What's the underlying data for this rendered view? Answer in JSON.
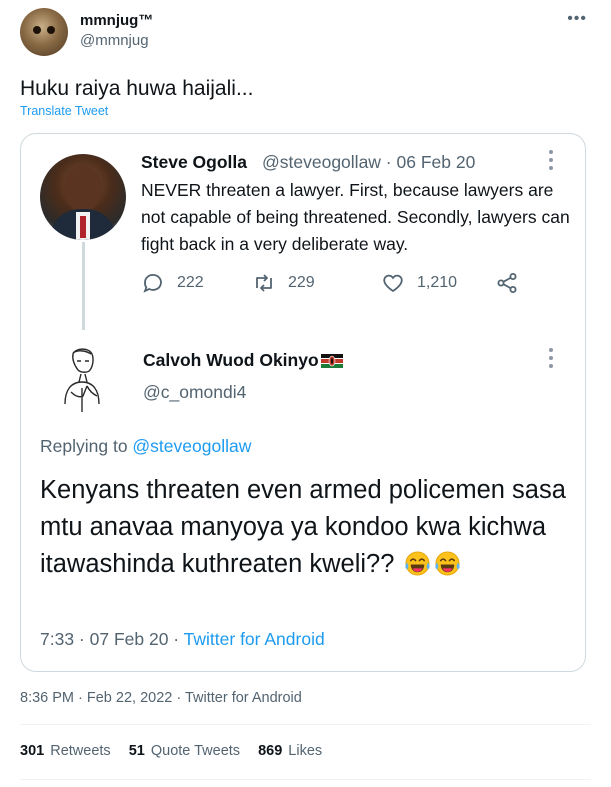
{
  "tweet": {
    "display_name": "mmnjug™",
    "handle": "@mmnjug",
    "text": "Huku raiya huwa haijali...",
    "translate_label": "Translate Tweet",
    "more_icon": "more-horizontal-icon"
  },
  "quote": {
    "parent": {
      "name": "Steve Ogolla",
      "handle_date": "@steveogollaw · 06 Feb 20",
      "text": "NEVER threaten a lawyer. First, because lawyers are not capable of being threatened. Secondly, lawyers can fight back in a very deliberate way.",
      "replies": "222",
      "retweets": "229",
      "likes": "1,210"
    },
    "reply": {
      "name": "Calvoh Wuod Okinyo",
      "handle": "@c_omondi4",
      "replying_prefix": "Replying to ",
      "replying_handle": "@steveogollaw",
      "text": "Kenyans threaten even  armed policemen sasa mtu anavaa manyoya ya kondoo kwa kichwa itawashinda kuthreaten kweli??",
      "time_date": "7:33 · 07 Feb 20 · ",
      "source": "Twitter for Android"
    }
  },
  "meta": {
    "timestamp": "8:36 PM · Feb 22, 2022 · Twitter for Android"
  },
  "stats": {
    "retweets_count": "301",
    "retweets_label": "Retweets",
    "quotes_count": "51",
    "quotes_label": "Quote Tweets",
    "likes_count": "869",
    "likes_label": "Likes"
  },
  "colors": {
    "accent": "#1d9bf0",
    "secondary_text": "#536471",
    "border": "#cfd9de"
  }
}
